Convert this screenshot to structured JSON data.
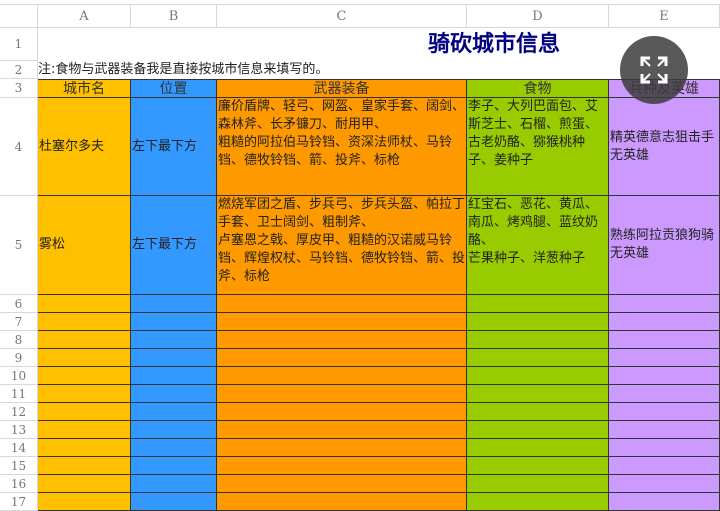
{
  "columns": [
    "A",
    "B",
    "C",
    "D",
    "E"
  ],
  "rows": [
    "1",
    "2",
    "3",
    "4",
    "5",
    "6",
    "7",
    "8",
    "9",
    "10",
    "11",
    "12",
    "13",
    "14",
    "15",
    "16",
    "17"
  ],
  "title": "骑砍城市信息",
  "note": "注:食物与武器装备我是直接按城市信息来填写的。",
  "headers": [
    "城市名",
    "位置",
    "武器装备",
    "食物",
    "兵种及英雄"
  ],
  "records": [
    {
      "city": "杜塞尔多夫",
      "position": "左下最下方",
      "weapons": "廉价盾牌、轻弓、网盔、皇家手套、阔剑、森林斧、长矛镰刀、耐用甲、\n粗糙的阿拉伯马铃铛、资深法师杖、马铃铛、德牧铃铛、箭、投斧、标枪",
      "food": "李子、大列巴面包、艾斯芝士、石榴、煎蛋、\n古老奶酪、猕猴桃种子、姜种子",
      "troops": "精英德意志狙击手\n无英雄"
    },
    {
      "city": "雾松",
      "position": "左下最下方",
      "weapons": "燃烧军团之盾、步兵弓、步兵头盔、帕拉丁手套、卫士阔剑、粗制斧、\n卢塞恩之戟、厚皮甲、粗糙的汉诺威马铃铛、辉煌权杖、马铃铛、德牧铃铛、箭、投斧、标枪",
      "food": "红宝石、恶花、黄瓜、南瓜、烤鸡腿、蓝纹奶酪、\n芒果种子、洋葱种子",
      "troops": "熟练阿拉贡狼狗骑\n无英雄"
    }
  ],
  "colors": {
    "A": "#ffc000",
    "B": "#3399ff",
    "C": "#ff9900",
    "D": "#99cc00",
    "E": "#cc99ff",
    "title": "#000080"
  },
  "overlay": {
    "icon": "fullscreen-expand-icon"
  }
}
